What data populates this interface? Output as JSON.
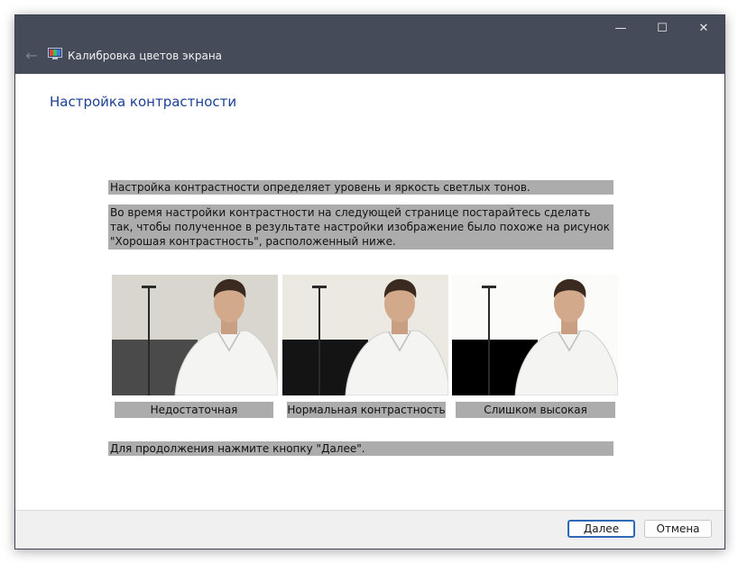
{
  "window": {
    "title": "Калибровка цветов экрана",
    "controls": {
      "minimize": "—",
      "maximize": "☐",
      "close": "✕"
    },
    "back_icon": "←"
  },
  "content": {
    "heading": "Настройка контрастности",
    "paragraph1": "Настройка контрастности определяет уровень и яркость светлых тонов.",
    "paragraph2": "Во время настройки контрастности на следующей странице постарайтесь сделать так, чтобы полученное в результате настройки изображение было похоже на рисунок \"Хорошая контрастность\", расположенный ниже.",
    "samples": [
      {
        "caption": "Недостаточная",
        "floor_color": "#4a4a4a",
        "bg_color": "#d9d6d0"
      },
      {
        "caption": "Нормальная контрастность",
        "floor_color": "#141414",
        "bg_color": "#ece9e3"
      },
      {
        "caption": "Слишком высокая",
        "floor_color": "#000000",
        "bg_color": "#fbfbfa"
      }
    ],
    "paragraph3": "Для продолжения нажмите кнопку \"Далее\"."
  },
  "footer": {
    "next_label": "Далее",
    "cancel_label": "Отмена"
  }
}
